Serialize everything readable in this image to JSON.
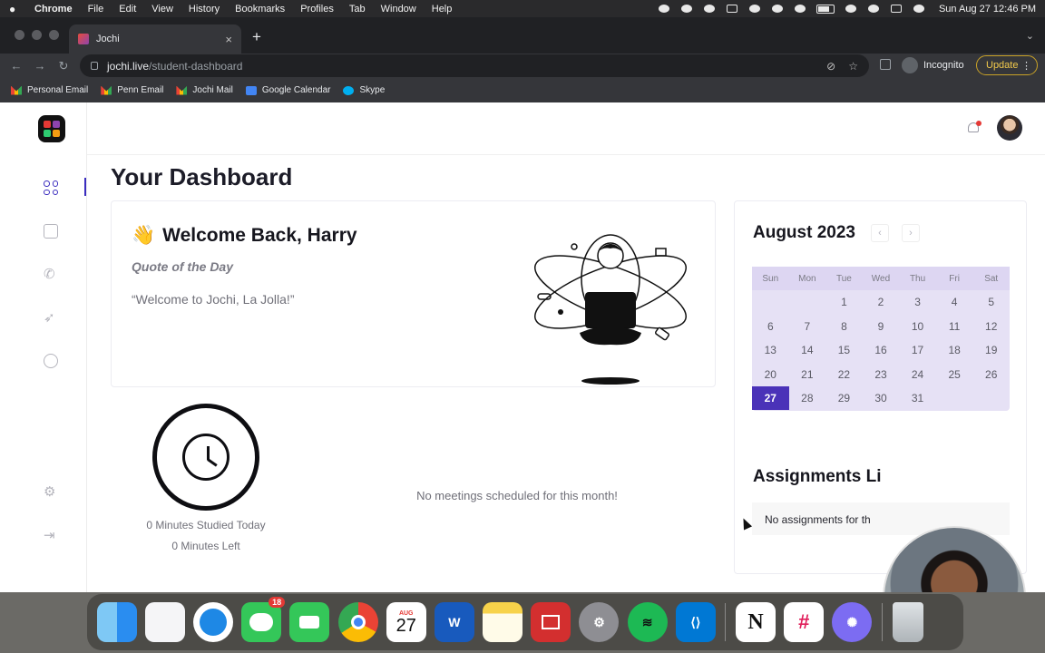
{
  "menubar": {
    "apple": "",
    "items": [
      "Chrome",
      "File",
      "Edit",
      "View",
      "History",
      "Bookmarks",
      "Profiles",
      "Tab",
      "Window",
      "Help"
    ],
    "clock": "Sun Aug 27  12:46 PM"
  },
  "browser": {
    "tab_title": "Jochi",
    "tab_close": "×",
    "new_tab": "+",
    "url_host": "jochi.live",
    "url_path": "/student-dashboard",
    "profile_label": "Incognito",
    "update_label": "Update",
    "update_more": "⋮",
    "nav": {
      "back": "←",
      "forward": "→",
      "reload": "↻"
    },
    "bookmarks": [
      {
        "label": "Personal Email",
        "icon": "gmail-icon"
      },
      {
        "label": "Penn Email",
        "icon": "gmail-icon"
      },
      {
        "label": "Jochi Mail",
        "icon": "gmail-icon"
      },
      {
        "label": "Google Calendar",
        "icon": "google-calendar-icon"
      },
      {
        "label": "Skype",
        "icon": "skype-icon"
      }
    ]
  },
  "page": {
    "title": "Your Dashboard",
    "welcome": {
      "emoji": "👋",
      "heading": "Welcome Back, Harry",
      "quote_label": "Quote of the Day",
      "quote": "“Welcome to Jochi, La Jolla!”"
    },
    "study": {
      "minutes_studied": "0 Minutes Studied Today",
      "minutes_left": "0 Minutes Left"
    },
    "meetings_empty": "No meetings scheduled for this month!",
    "calendar": {
      "month": "August 2023",
      "prev": "‹",
      "next": "›",
      "weekdays": [
        "Sun",
        "Mon",
        "Tue",
        "Wed",
        "Thu",
        "Fri",
        "Sat"
      ],
      "weeks": [
        [
          "",
          "",
          "1",
          "2",
          "3",
          "4",
          "5"
        ],
        [
          "6",
          "7",
          "8",
          "9",
          "10",
          "11",
          "12"
        ],
        [
          "13",
          "14",
          "15",
          "16",
          "17",
          "18",
          "19"
        ],
        [
          "20",
          "21",
          "22",
          "23",
          "24",
          "25",
          "26"
        ],
        [
          "27",
          "28",
          "29",
          "30",
          "31",
          "",
          ""
        ]
      ],
      "selected": "27",
      "accent": "#4a32b8"
    },
    "assignments_title": "Assignments Li",
    "assignments_empty": "No assignments for th"
  },
  "dock": {
    "messages_badge": "18",
    "calendar_month": "AUG",
    "calendar_day": "27",
    "apps": [
      "finder-icon",
      "launchpad-icon",
      "safari-icon",
      "messages-icon",
      "facetime-icon",
      "chrome-icon",
      "calendar-icon",
      "word-icon",
      "notes-icon",
      "photo-booth-icon",
      "system-settings-icon",
      "spotify-icon",
      "vscode-icon",
      "notion-icon",
      "slack-icon",
      "zoom-icon",
      "trash-icon"
    ]
  }
}
